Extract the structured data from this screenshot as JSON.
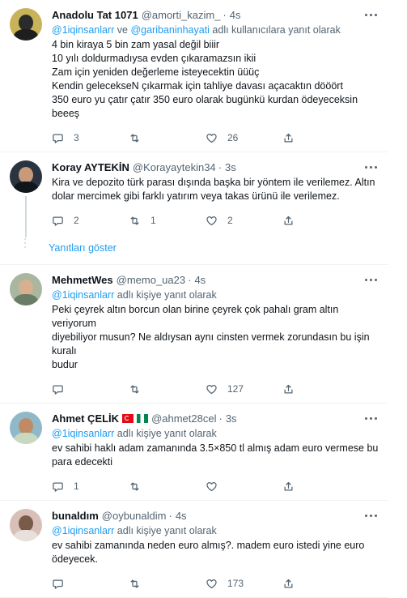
{
  "tweets": [
    {
      "name": "Anadolu Tat 1071",
      "handle": "@amorti_kazim_",
      "dot": "·",
      "time": "4s",
      "reply_mention_1": "@1iqinsanlarr",
      "reply_joiner": " ve ",
      "reply_mention_2": "@garibaninhayati",
      "reply_suffix": " adlı kullanıcılara yanıt olarak",
      "text": "4 bin kiraya 5 bin zam yasal değil biiir\n10 yılı doldurmadıysa evden çıkaramazsın ikii\nZam için yeniden değerleme isteyecektin üüüç\nKendin gelecekseN çıkarmak için tahliye davası açacaktın dööört\n350 euro yu çatır çatır 350 euro olarak bugünkü kurdan ödeyeceksin beeeş",
      "replies": "3",
      "retweets": "",
      "likes": "26",
      "avatar_color": "#c8b35a"
    },
    {
      "name": "Koray AYTEKİN",
      "handle": "@Korayaytekin34",
      "dot": "·",
      "time": "3s",
      "text": "Kira ve depozito türk parası dışında başka bir yöntem ile verilemez. Altın\ndolar mercimek gibi farklı yatırım veya takas ürünü ile verilemez.",
      "replies": "2",
      "retweets": "1",
      "likes": "2",
      "avatar_color": "#2a3340"
    },
    {
      "name": "MehmetWes",
      "handle": "@memo_ua23",
      "dot": "·",
      "time": "4s",
      "reply_mention": "@1iqinsanlarr",
      "reply_suffix": " adlı kişiye yanıt olarak",
      "text": "Peki çeyrek altın borcun olan birine çeyrek çok pahalı gram altın veriyorum\ndiyebiliyor musun? Ne aldıysan aynı cinsten vermek zorundasın bu işin kuralı\nbudur",
      "replies": "",
      "retweets": "",
      "likes": "127",
      "avatar_color": "#a9b6a0"
    },
    {
      "name": "Ahmet ÇELİK",
      "handle": "@ahmet28cel",
      "dot": "·",
      "time": "3s",
      "reply_mention": "@1iqinsanlarr",
      "reply_suffix": " adlı kişiye yanıt olarak",
      "text": "ev sahibi haklı adam zamanında 3.5×850 tl almış adam euro vermese bu\npara edecekti",
      "replies": "1",
      "retweets": "",
      "likes": "",
      "avatar_color": "#8fb9c8"
    },
    {
      "name": "bunaldım",
      "handle": "@oybunaldim",
      "dot": "·",
      "time": "4s",
      "reply_mention": "@1iqinsanlarr",
      "reply_suffix": " adlı kişiye yanıt olarak",
      "text": "ev sahibi zamanında neden euro almış?. madem euro istedi yine euro\nödeyecek.",
      "replies": "",
      "retweets": "",
      "likes": "173",
      "avatar_color": "#d8c0b8"
    }
  ],
  "show_replies": "Yanıtları göster",
  "colors": {
    "accent": "#1d9bf0",
    "muted": "#536471",
    "border": "#eff3f4"
  },
  "icons": [
    "reply-icon",
    "retweet-icon",
    "like-icon",
    "share-icon",
    "more-icon"
  ]
}
